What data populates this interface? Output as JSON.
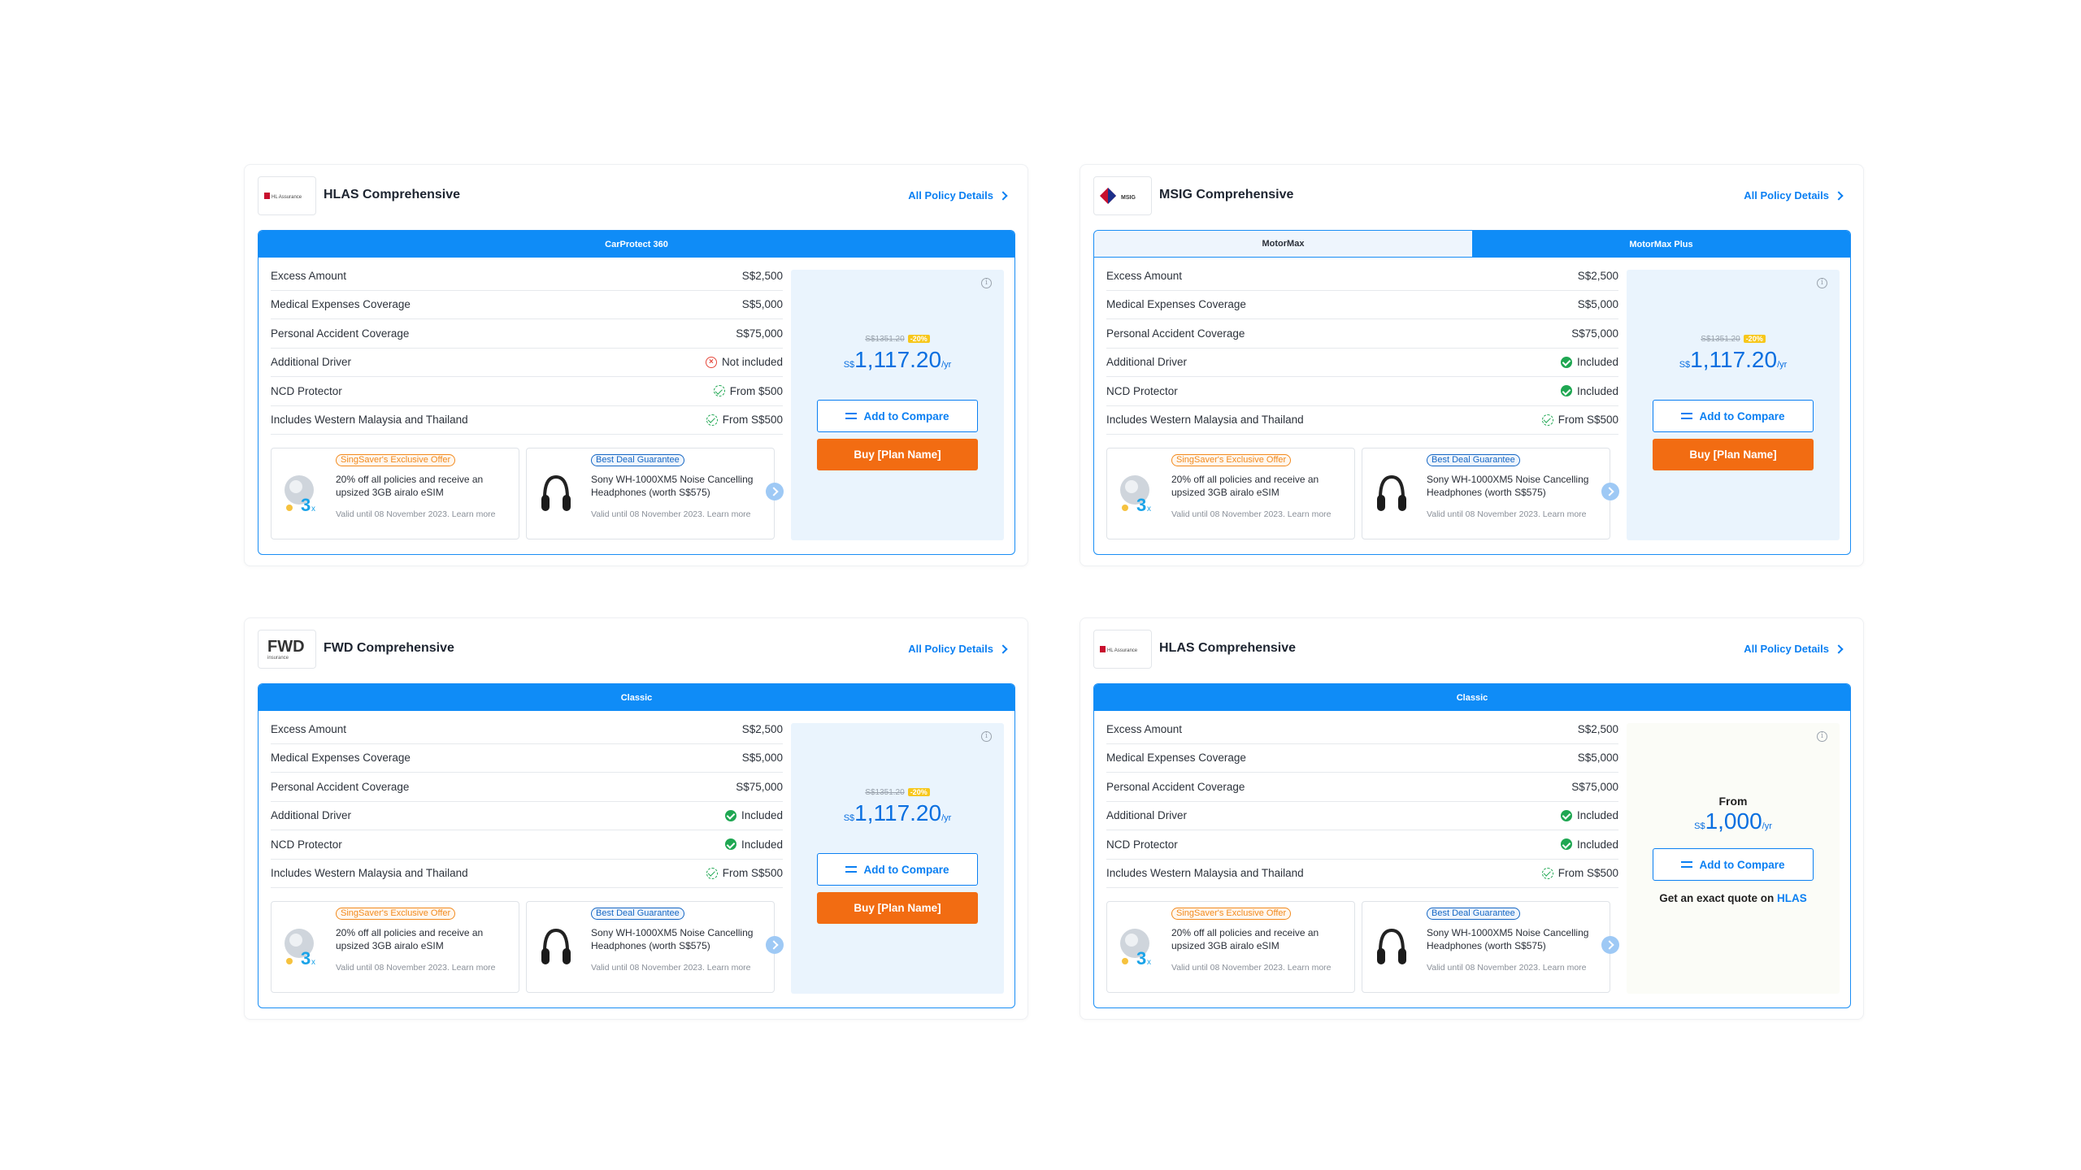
{
  "cards": [
    {
      "title": "HLAS Comprehensive",
      "logo": "HL Assurance",
      "details_link": "All Policy Details",
      "tabs": [
        "CarProtect 360"
      ],
      "rows": [
        {
          "label": "Excess Amount",
          "value": "S$2,500",
          "icon": ""
        },
        {
          "label": "Medical Expenses Coverage",
          "value": "S$5,000",
          "icon": ""
        },
        {
          "label": "Personal Accident Coverage",
          "value": "S$75,000",
          "icon": ""
        },
        {
          "label": "Additional Driver",
          "value": "Not included",
          "icon": "x-icon"
        },
        {
          "label": "NCD Protector",
          "value": "From $500",
          "icon": "partial-check-icon"
        },
        {
          "label": "Includes Western Malaysia and Thailand",
          "value": "From S$500",
          "icon": "partial-check-icon"
        }
      ],
      "price": {
        "old": "S$1351.20",
        "discount": "-20%",
        "currency": "S$",
        "amount": "1,117.20",
        "per": "/yr"
      },
      "compare_label": "Add to Compare",
      "buy_label": "Buy [Plan Name]"
    },
    {
      "title": "MSIG Comprehensive",
      "logo": "MSIG",
      "details_link": "All Policy Details",
      "tabs": [
        "MotorMax",
        "MotorMax Plus"
      ],
      "rows": [
        {
          "label": "Excess Amount",
          "value": "S$2,500",
          "icon": ""
        },
        {
          "label": "Medical Expenses Coverage",
          "value": "S$5,000",
          "icon": ""
        },
        {
          "label": "Personal Accident Coverage",
          "value": "S$75,000",
          "icon": ""
        },
        {
          "label": "Additional Driver",
          "value": "Included",
          "icon": "check-icon"
        },
        {
          "label": "NCD Protector",
          "value": "Included",
          "icon": "check-icon"
        },
        {
          "label": "Includes Western Malaysia and Thailand",
          "value": "From S$500",
          "icon": "partial-check-icon"
        }
      ],
      "price": {
        "old": "S$1351.20",
        "discount": "-20%",
        "currency": "S$",
        "amount": "1,117.20",
        "per": "/yr"
      },
      "compare_label": "Add to Compare",
      "buy_label": "Buy [Plan Name]"
    },
    {
      "title": "FWD Comprehensive",
      "logo": "FWD",
      "logo_sub": "insurance",
      "details_link": "All Policy Details",
      "tabs": [
        "Classic"
      ],
      "rows": [
        {
          "label": "Excess Amount",
          "value": "S$2,500",
          "icon": ""
        },
        {
          "label": "Medical Expenses Coverage",
          "value": "S$5,000",
          "icon": ""
        },
        {
          "label": "Personal Accident Coverage",
          "value": "S$75,000",
          "icon": ""
        },
        {
          "label": "Additional Driver",
          "value": "Included",
          "icon": "check-icon"
        },
        {
          "label": "NCD Protector",
          "value": "Included",
          "icon": "check-icon"
        },
        {
          "label": "Includes Western Malaysia and Thailand",
          "value": "From S$500",
          "icon": "partial-check-icon"
        }
      ],
      "price": {
        "old": "S$1351.20",
        "discount": "-20%",
        "currency": "S$",
        "amount": "1,117.20",
        "per": "/yr"
      },
      "compare_label": "Add to Compare",
      "buy_label": "Buy [Plan Name]"
    },
    {
      "title": "HLAS Comprehensive",
      "logo": "HL Assurance",
      "details_link": "All Policy Details",
      "tabs": [
        "Classic"
      ],
      "rows": [
        {
          "label": "Excess Amount",
          "value": "S$2,500",
          "icon": ""
        },
        {
          "label": "Medical Expenses Coverage",
          "value": "S$5,000",
          "icon": ""
        },
        {
          "label": "Personal Accident Coverage",
          "value": "S$75,000",
          "icon": ""
        },
        {
          "label": "Additional Driver",
          "value": "Included",
          "icon": "check-icon"
        },
        {
          "label": "NCD Protector",
          "value": "Included",
          "icon": "check-icon"
        },
        {
          "label": "Includes Western Malaysia and Thailand",
          "value": "From S$500",
          "icon": "partial-check-icon"
        }
      ],
      "price": {
        "from": "From",
        "currency": "S$",
        "amount": "1,000",
        "per": "/yr"
      },
      "compare_label": "Add to Compare",
      "quote_text": "Get an exact quote on",
      "quote_link": "HLAS"
    }
  ],
  "offers": [
    {
      "badge": "SingSaver's Exclusive Offer",
      "desc": "20% off all policies and receive an upsized 3GB airalo eSIM",
      "valid": "Valid until 08 November 2023. Learn more",
      "icon": "esim-3x-icon"
    },
    {
      "badge": "Best Deal Guarantee",
      "desc": "Sony WH-1000XM5 Noise Cancelling Headphones (worth S$575)",
      "valid": "Valid until 08 November 2023. Learn more",
      "icon": "headphones-icon"
    }
  ],
  "colors": {
    "primary": "#0f8cf7",
    "buy": "#f26c12",
    "price_panel": "#eaf4fd",
    "included": "#1fa752",
    "not_included": "#e5483c",
    "discount": "#f7c71b"
  }
}
